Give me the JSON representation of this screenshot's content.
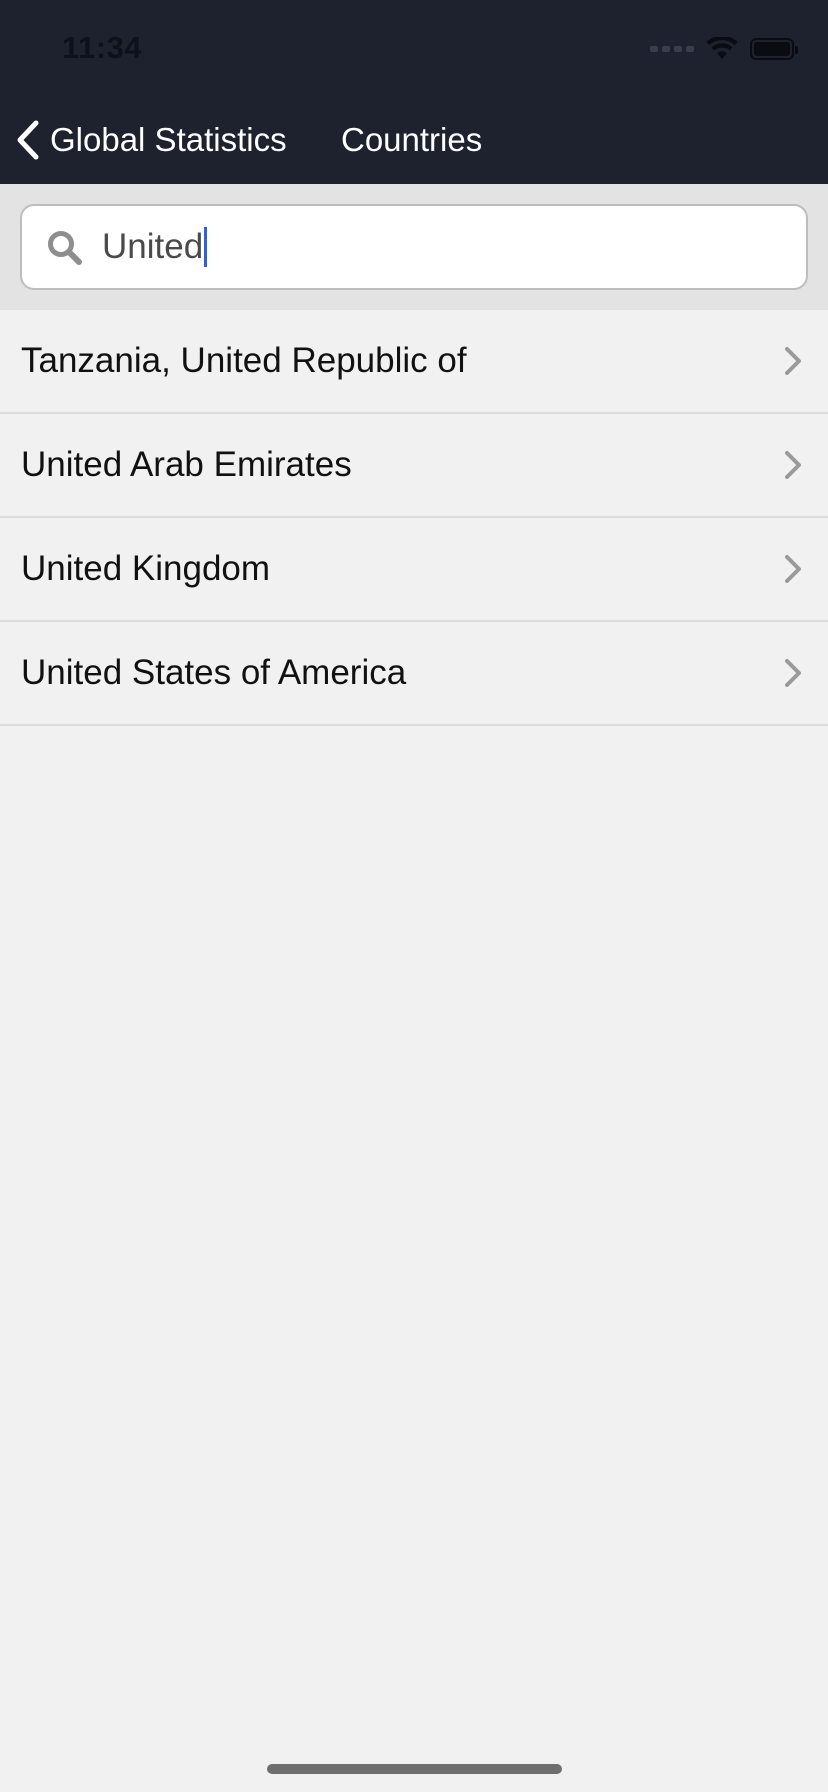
{
  "status_bar": {
    "time": "11:34"
  },
  "nav": {
    "back_label": "Global Statistics",
    "title": "Countries"
  },
  "search": {
    "value": "United",
    "icon": "search-icon"
  },
  "results": [
    {
      "label": "Tanzania, United Republic of"
    },
    {
      "label": "United Arab Emirates"
    },
    {
      "label": "United Kingdom"
    },
    {
      "label": "United States of America"
    }
  ],
  "colors": {
    "nav_background": "#1e212e",
    "search_area": "#e3e3e3",
    "list_background": "#f1f1f1",
    "caret": "#2f5fe0"
  }
}
